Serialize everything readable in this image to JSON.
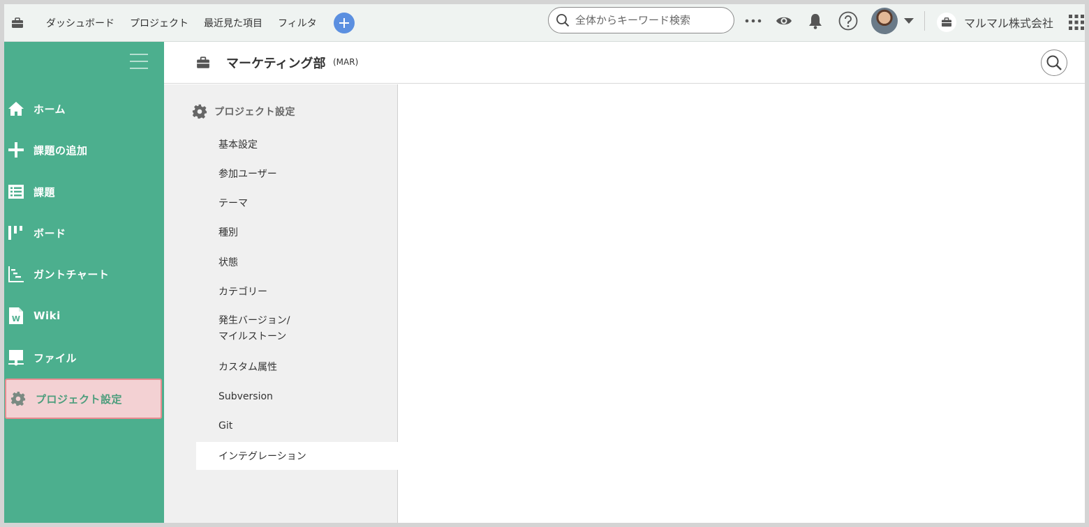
{
  "topbar": {
    "nav": [
      "ダッシュボード",
      "プロジェクト",
      "最近見た項目",
      "フィルタ"
    ],
    "search_placeholder": "全体からキーワード検索",
    "org_name": "マルマル株式会社",
    "icons": [
      "briefcase-icon",
      "plus-icon",
      "search-icon",
      "more-icon",
      "eye-icon",
      "bell-icon",
      "help-icon",
      "avatar",
      "chevron-down-icon",
      "apps-icon"
    ]
  },
  "sidebar": {
    "items": [
      {
        "label": "ホーム",
        "icon": "home-icon"
      },
      {
        "label": "課題の追加",
        "icon": "plus-icon"
      },
      {
        "label": "課題",
        "icon": "list-icon"
      },
      {
        "label": "ボード",
        "icon": "board-icon"
      },
      {
        "label": "ガントチャート",
        "icon": "gantt-icon"
      },
      {
        "label": "Wiki",
        "icon": "wiki-icon"
      },
      {
        "label": "ファイル",
        "icon": "file-icon"
      },
      {
        "label": "プロジェクト設定",
        "icon": "gear-icon",
        "active": true
      }
    ]
  },
  "project": {
    "title": "マーケティング部",
    "key": "(MAR)"
  },
  "settings": {
    "heading": "プロジェクト設定",
    "items": [
      "基本設定",
      "参加ユーザー",
      "テーマ",
      "種別",
      "状態",
      "カテゴリー",
      [
        "発生バージョン/",
        "マイルストーン"
      ],
      "カスタム属性",
      "Subversion",
      "Git",
      "インテグレーション"
    ],
    "selected": "インテグレーション"
  },
  "colors": {
    "sidebar_bg": "#4caf8e",
    "active_item_bg": "#f3d1d3",
    "active_item_border": "#e88a8f",
    "plus_button": "#5b8fe0"
  }
}
